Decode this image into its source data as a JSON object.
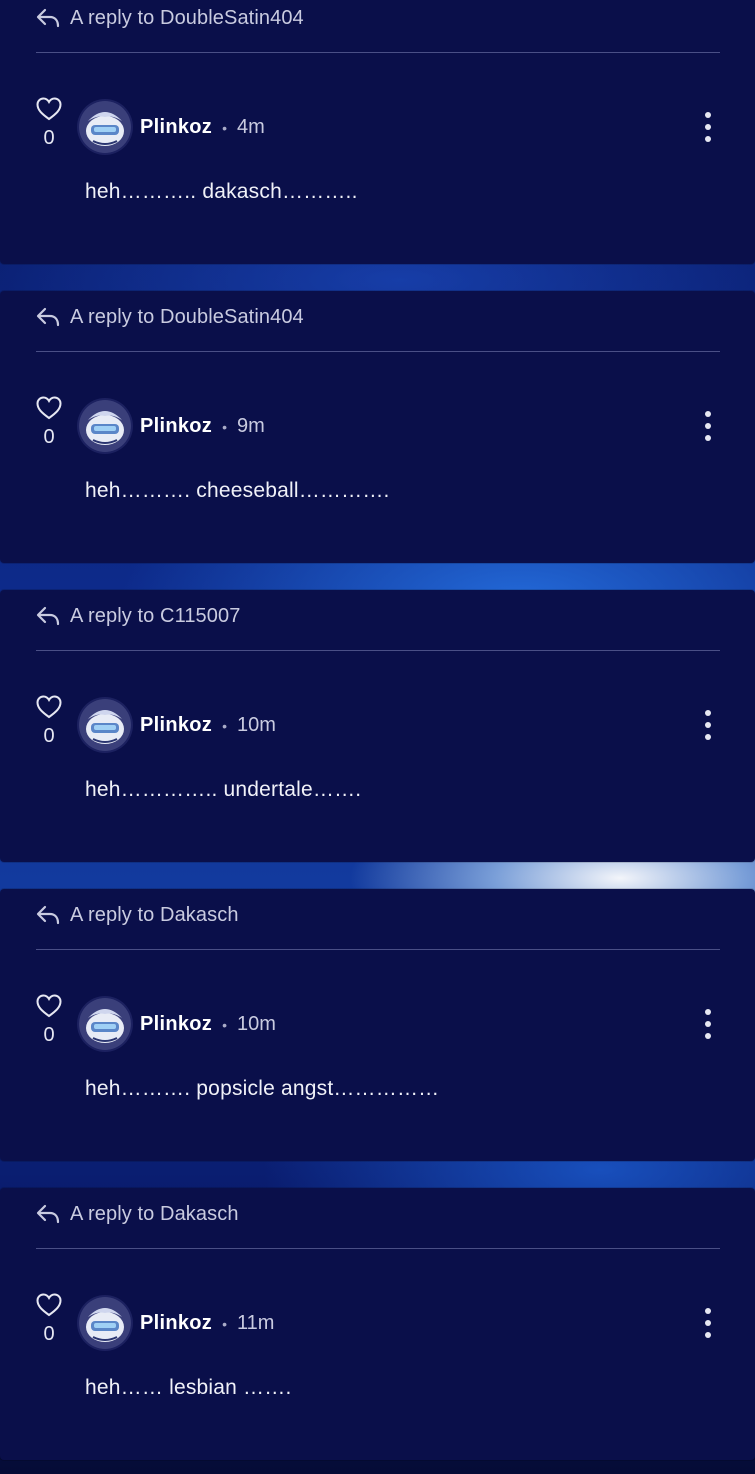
{
  "comments": [
    {
      "reply_to": "A reply to DoubleSatin404",
      "likes": "0",
      "author": "Plinkoz",
      "separator": "•",
      "time": "4m",
      "text": "heh……….. dakasch……….."
    },
    {
      "reply_to": "A reply to DoubleSatin404",
      "likes": "0",
      "author": "Plinkoz",
      "separator": "•",
      "time": "9m",
      "text": "heh………. cheeseball…………."
    },
    {
      "reply_to": "A reply to C115007",
      "likes": "0",
      "author": "Plinkoz",
      "separator": "•",
      "time": "10m",
      "text": "heh………….. undertale……."
    },
    {
      "reply_to": "A reply to Dakasch",
      "likes": "0",
      "author": "Plinkoz",
      "separator": "•",
      "time": "10m",
      "text": "heh………. popsicle angst……………"
    },
    {
      "reply_to": "A reply to Dakasch",
      "likes": "0",
      "author": "Plinkoz",
      "separator": "•",
      "time": "11m",
      "text": "heh…… lesbian ……."
    }
  ],
  "icons": {
    "reply": "reply-arrow-icon",
    "like": "heart-icon",
    "menu": "more-vertical-icon"
  },
  "colors": {
    "card_background": "#0a0f4a",
    "text_primary": "#ffffff",
    "text_secondary": "#c9cbe0",
    "divider": "#4a4f86"
  }
}
